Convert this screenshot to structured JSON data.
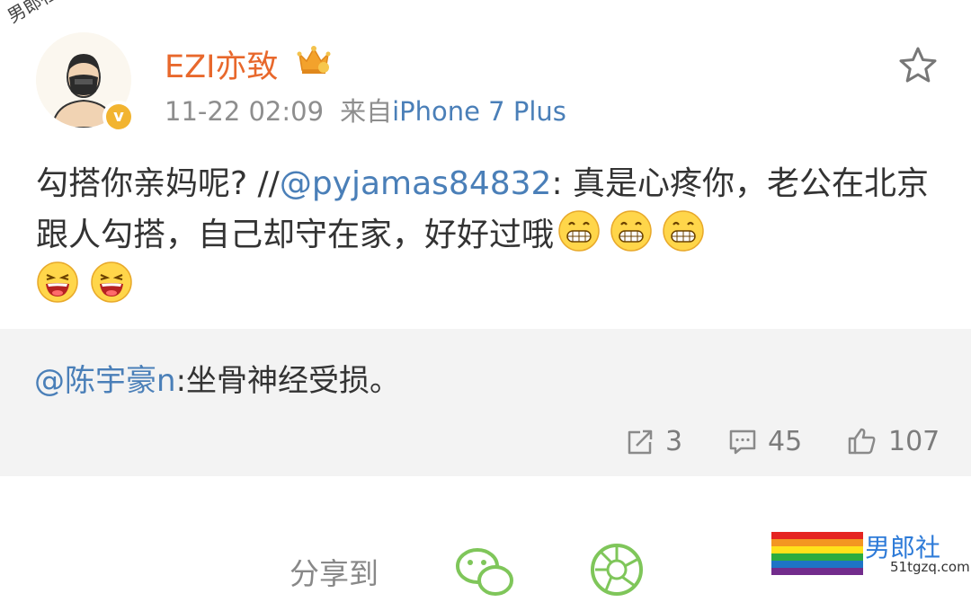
{
  "post": {
    "username": "EZI亦致",
    "timestamp": "11-22 02:09",
    "source_prefix": "来自",
    "source_device": "iPhone 7 Plus",
    "content_part1": "勾搭你亲妈呢? //",
    "content_mention": "@pyjamas84832",
    "content_part2": ": 真是心疼你，老公在北京跟人勾搭，自己却守在家，好好过哦"
  },
  "repost": {
    "mention": "@陈宇豪n",
    "text": ":坐骨神经受损。"
  },
  "actions": {
    "reposts": "3",
    "comments": "45",
    "likes": "107"
  },
  "share": {
    "label": "分享到"
  },
  "watermark": {
    "top_left": "男郎社",
    "bottom_right_title": "男郎社",
    "bottom_right_url": "51tgzq.com"
  },
  "icons": {
    "favorite": "star-icon",
    "repost": "repost-icon",
    "comment": "comment-icon",
    "like": "like-icon",
    "wechat": "wechat-icon",
    "moments": "moments-icon",
    "grin_emoji": "grin-emoji",
    "laugh_emoji": "laugh-emoji",
    "verified": "verified-badge-icon"
  },
  "colors": {
    "username": "#e8682c",
    "link": "#4a7fb8",
    "verified_badge": "#f2b430",
    "share_icon": "#7fc65a"
  }
}
